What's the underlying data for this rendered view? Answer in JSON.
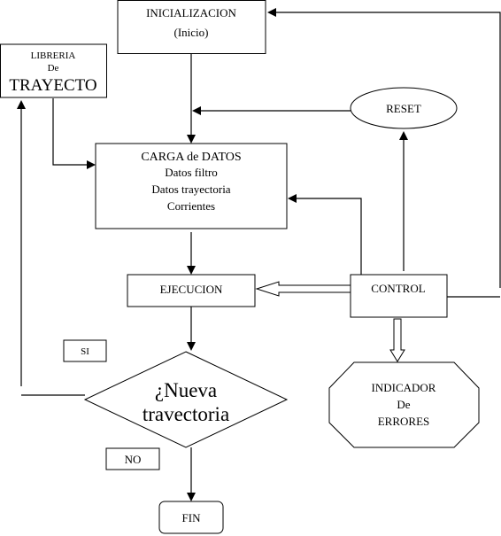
{
  "diagram": {
    "type": "flowchart",
    "nodes": {
      "inicializacion": {
        "lines": [
          "INICIALIZACION",
          "(Inicio)"
        ],
        "shape": "rectangle"
      },
      "libreria": {
        "lines": [
          "LIBRERIA",
          "De",
          "TRAYECTO"
        ],
        "shape": "rectangle"
      },
      "reset": {
        "lines": [
          "RESET"
        ],
        "shape": "ellipse"
      },
      "carga": {
        "lines": [
          "CARGA de DATOS",
          "Datos filtro",
          "Datos trayectoria",
          "Corrientes"
        ],
        "shape": "rectangle"
      },
      "ejecucion": {
        "lines": [
          "EJECUCION"
        ],
        "shape": "rectangle"
      },
      "control": {
        "lines": [
          "CONTROL"
        ],
        "shape": "rectangle"
      },
      "decision": {
        "lines": [
          "¿Nueva",
          "travectoria"
        ],
        "shape": "diamond"
      },
      "indicador": {
        "lines": [
          "INDICADOR",
          "De",
          "ERRORES"
        ],
        "shape": "octagon"
      },
      "fin": {
        "lines": [
          "FIN"
        ],
        "shape": "rounded-rectangle"
      }
    },
    "branch_labels": {
      "si": "SI",
      "no": "NO"
    },
    "edges": [
      {
        "from": "inicializacion",
        "to": "carga"
      },
      {
        "from": "reset",
        "to": "carga"
      },
      {
        "from": "libreria",
        "to": "carga"
      },
      {
        "from": "control",
        "to": "carga"
      },
      {
        "from": "control",
        "to": "reset"
      },
      {
        "from": "control",
        "to": "inicializacion"
      },
      {
        "from": "carga",
        "to": "ejecucion"
      },
      {
        "from": "control",
        "to": "ejecucion",
        "style": "hollow-block"
      },
      {
        "from": "control",
        "to": "indicador",
        "style": "hollow-block"
      },
      {
        "from": "ejecucion",
        "to": "decision"
      },
      {
        "from": "decision",
        "to": "libreria",
        "label": "SI"
      },
      {
        "from": "decision",
        "to": "fin",
        "label": "NO"
      }
    ]
  }
}
